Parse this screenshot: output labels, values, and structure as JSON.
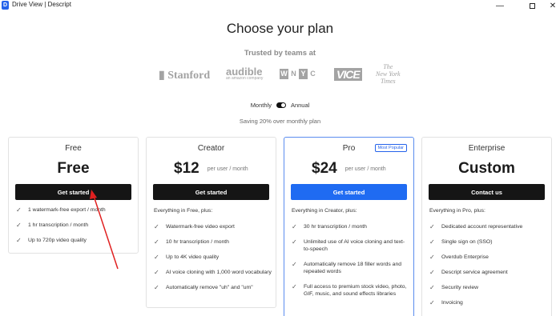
{
  "window": {
    "app_icon": "D",
    "title": "Drive View | Descript",
    "minimize_glyph": "—",
    "close_glyph": "✕"
  },
  "header": {
    "title": "Choose your plan",
    "trusted_label": "Trusted by teams at"
  },
  "logos": {
    "stanford": "Stanford",
    "audible": "audible",
    "audible_sub": "an amazon company",
    "wnyc": [
      "W",
      "N",
      "Y",
      "C"
    ],
    "vice": "VICE",
    "nyt": [
      "The",
      "New York",
      "Times"
    ]
  },
  "billing": {
    "monthly_label": "Monthly",
    "annual_label": "Annual",
    "annual_selected": true,
    "saving_note": "Saving 20% over monthly plan"
  },
  "plans": [
    {
      "name": "Free",
      "price": "Free",
      "cta": "Get started",
      "features": [
        "1 watermark-free export / month",
        "1 hr transcription / month",
        "Up to 720p video quality"
      ]
    },
    {
      "name": "Creator",
      "price": "$12",
      "per": "per user / month",
      "cta": "Get started",
      "intro": "Everything in Free, plus:",
      "features": [
        "Watermark-free video export",
        "10 hr transcription / month",
        "Up to 4K video quality",
        "AI voice cloning with 1,000 word vocabulary",
        "Automatically remove \"uh\" and \"um\""
      ]
    },
    {
      "name": "Pro",
      "badge": "Most Popular",
      "price": "$24",
      "per": "per user / month",
      "cta": "Get started",
      "intro": "Everything in Creator, plus:",
      "features": [
        "30 hr transcription / month",
        "Unlimited use of AI voice cloning and text-to-speech",
        "Automatically remove 18 filler words and repeated words",
        "Full access to premium stock video, photo, GIF, music, and sound effects libraries"
      ]
    },
    {
      "name": "Enterprise",
      "price": "Custom",
      "cta": "Contact us",
      "intro": "Everything in Pro, plus:",
      "features": [
        "Dedicated account representative",
        "Single sign on (SSO)",
        "Overdub Enterprise",
        "Descript service agreement",
        "Security review",
        "Invoicing"
      ]
    }
  ],
  "icons": {
    "check": "✓"
  },
  "colors": {
    "accent": "#1f6bf2",
    "cta_dark": "#151515",
    "annotation_arrow": "#e02020"
  }
}
